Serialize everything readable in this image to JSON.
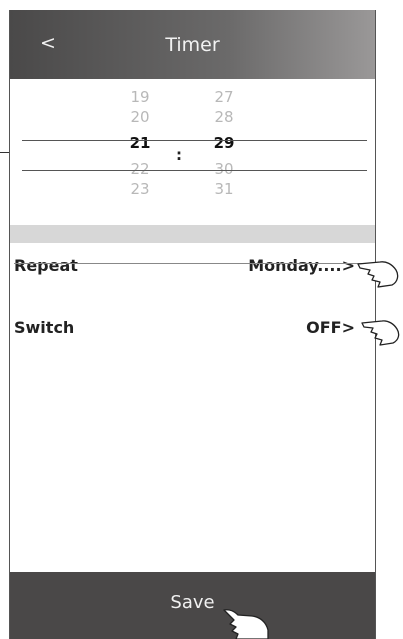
{
  "header": {
    "back_label": "<",
    "title": "Timer"
  },
  "picker": {
    "hours": [
      "19",
      "20",
      "21",
      "22",
      "23"
    ],
    "minutes": [
      "27",
      "28",
      "29",
      "30",
      "31"
    ],
    "separator": ":"
  },
  "settings": {
    "repeat": {
      "label": "Repeat",
      "value": "Monday....>"
    },
    "switch": {
      "label": "Switch",
      "value": "OFF>"
    }
  },
  "footer": {
    "save_label": "Save"
  },
  "colors": {
    "header": "#4a4949",
    "footer": "#4a4848",
    "band": "#d7d7d7"
  }
}
